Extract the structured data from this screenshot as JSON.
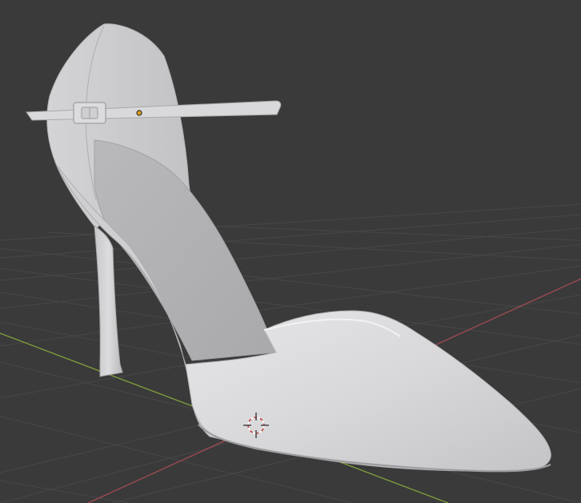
{
  "viewport": {
    "background_color": "#3a3a3a",
    "grid_color": "#474747",
    "x_axis_color": "#9b4a51",
    "y_axis_color": "#7d9a3c",
    "grid_visible": true
  },
  "model": {
    "object": "high-heel-shoe",
    "material_color": "#c9c9cb",
    "shading": "solid"
  },
  "gizmos": {
    "origin_icon": "origin-point-icon",
    "origin_color": "#e5a11a",
    "cursor_icon": "3d-cursor-icon",
    "cursor_colors": [
      "#c8403c",
      "#ffffff"
    ]
  }
}
